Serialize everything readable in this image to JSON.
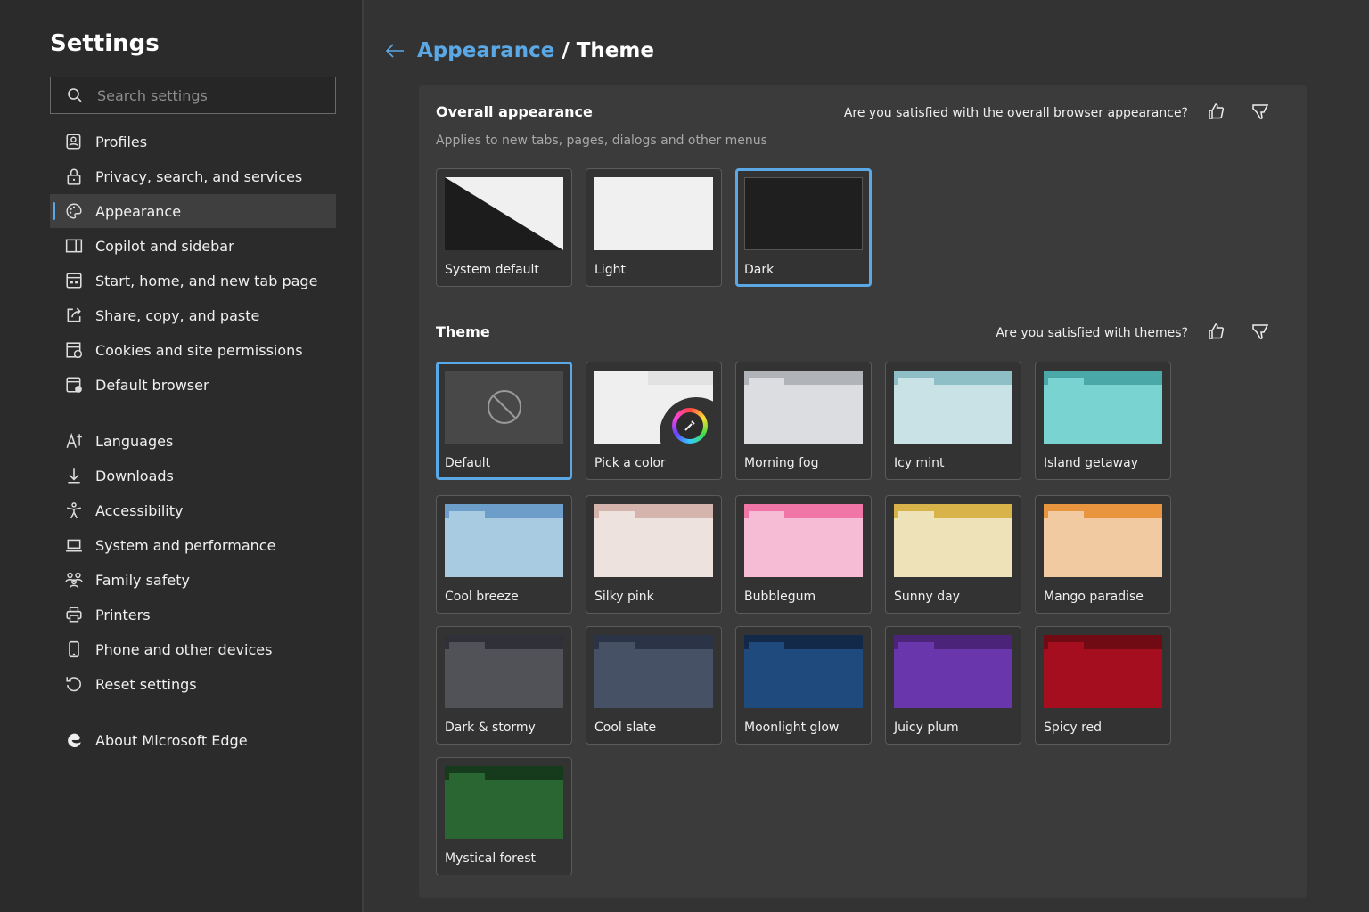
{
  "sidebar": {
    "title": "Settings",
    "search_placeholder": "Search settings",
    "items": [
      {
        "label": "Profiles",
        "icon": "profile-icon"
      },
      {
        "label": "Privacy, search, and services",
        "icon": "lock-icon"
      },
      {
        "label": "Appearance",
        "icon": "palette-icon",
        "active": true
      },
      {
        "label": "Copilot and sidebar",
        "icon": "sidebar-icon"
      },
      {
        "label": "Start, home, and new tab page",
        "icon": "home-tab-icon"
      },
      {
        "label": "Share, copy, and paste",
        "icon": "share-icon"
      },
      {
        "label": "Cookies and site permissions",
        "icon": "cookies-icon"
      },
      {
        "label": "Default browser",
        "icon": "browser-icon"
      },
      {
        "label": "Languages",
        "icon": "languages-icon"
      },
      {
        "label": "Downloads",
        "icon": "download-icon"
      },
      {
        "label": "Accessibility",
        "icon": "accessibility-icon"
      },
      {
        "label": "System and performance",
        "icon": "laptop-icon"
      },
      {
        "label": "Family safety",
        "icon": "family-icon"
      },
      {
        "label": "Printers",
        "icon": "printer-icon"
      },
      {
        "label": "Phone and other devices",
        "icon": "phone-icon"
      },
      {
        "label": "Reset settings",
        "icon": "reset-icon"
      },
      {
        "label": "About Microsoft Edge",
        "icon": "edge-icon"
      }
    ]
  },
  "breadcrumb": {
    "parent": "Appearance",
    "separator": "/",
    "current": "Theme"
  },
  "overall": {
    "title": "Overall appearance",
    "subtitle": "Applies to new tabs, pages, dialogs and other menus",
    "question": "Are you satisfied with the overall browser appearance?",
    "options": [
      {
        "label": "System default",
        "selected": false
      },
      {
        "label": "Light",
        "selected": false
      },
      {
        "label": "Dark",
        "selected": true
      }
    ]
  },
  "theme": {
    "title": "Theme",
    "question": "Are you satisfied with themes?",
    "options": [
      {
        "label": "Default",
        "selected": true
      },
      {
        "label": "Pick a color"
      },
      {
        "label": "Morning fog",
        "strip": "#b0b3b7",
        "body": "#dcdde0"
      },
      {
        "label": "Icy mint",
        "strip": "#8fbfc6",
        "body": "#c9e2e6"
      },
      {
        "label": "Island getaway",
        "strip": "#4aa8a8",
        "body": "#79d3d1"
      },
      {
        "label": "Cool breeze",
        "strip": "#6c9ec9",
        "body": "#a9cbe1"
      },
      {
        "label": "Silky pink",
        "strip": "#d6b4ae",
        "body": "#eee2df"
      },
      {
        "label": "Bubblegum",
        "strip": "#ef76a6",
        "body": "#f6bcd5"
      },
      {
        "label": "Sunny day",
        "strip": "#d8b34a",
        "body": "#eee2b9"
      },
      {
        "label": "Mango paradise",
        "strip": "#e9943e",
        "body": "#f2caa1"
      },
      {
        "label": "Dark & stormy",
        "strip": "#303138",
        "body": "#515257"
      },
      {
        "label": "Cool slate",
        "strip": "#2b3446",
        "body": "#465166"
      },
      {
        "label": "Moonlight glow",
        "strip": "#12294a",
        "body": "#1f4a7d"
      },
      {
        "label": "Juicy plum",
        "strip": "#4b2378",
        "body": "#6a36ac"
      },
      {
        "label": "Spicy red",
        "strip": "#700b14",
        "body": "#a50e1f"
      },
      {
        "label": "Mystical forest",
        "strip": "#153a1c",
        "body": "#2a6632"
      }
    ]
  },
  "colors": {
    "accent": "#5aa9e6"
  }
}
